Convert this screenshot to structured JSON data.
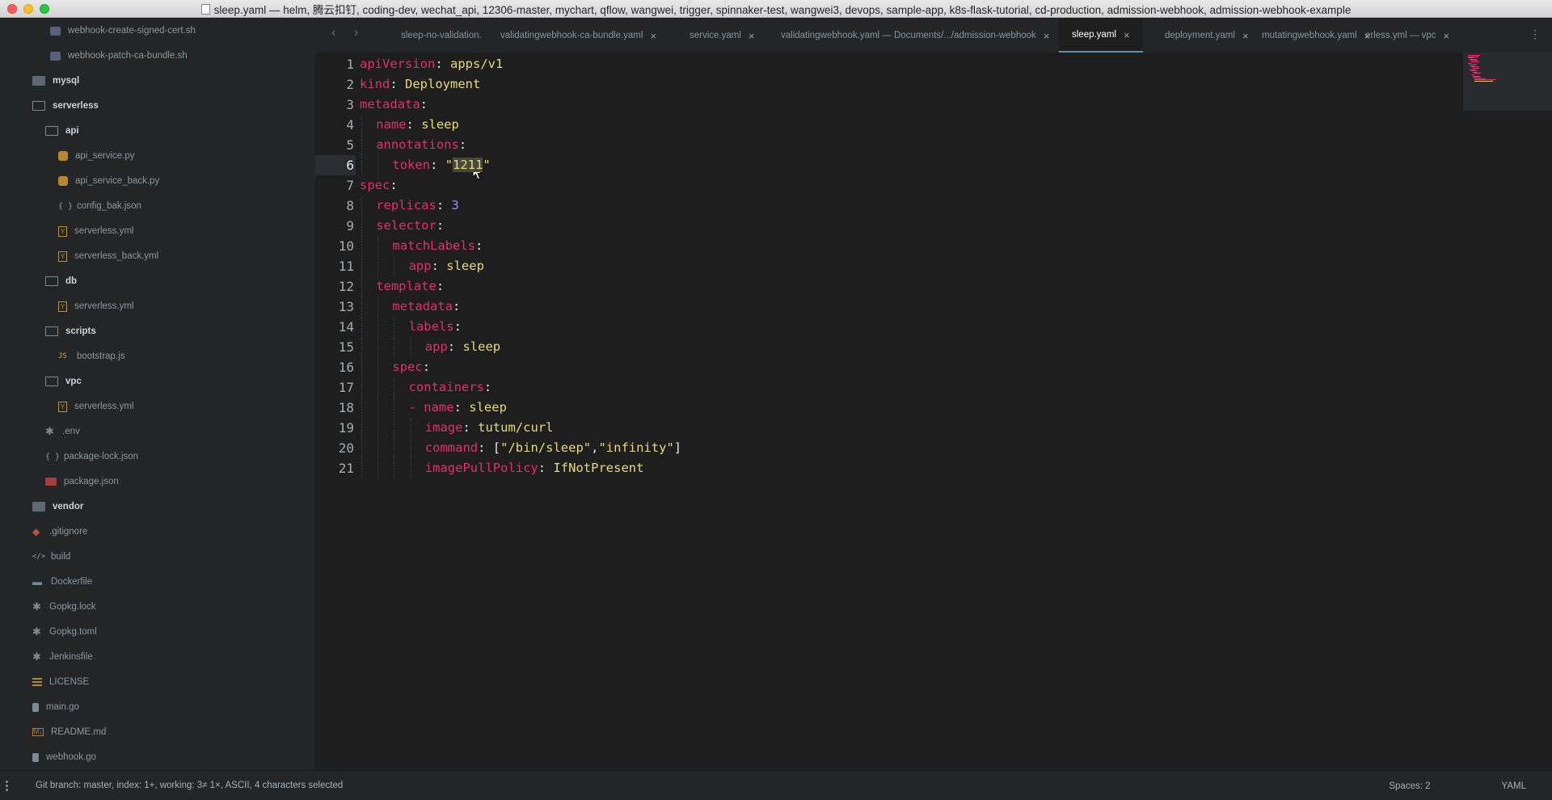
{
  "window": {
    "title": "sleep.yaml — helm, 腾云扣钉, coding-dev, wechat_api, 12306-master, mychart, qflow, wangwei, trigger, spinnaker-test, wangwei3, devops, sample-app, k8s-flask-tutorial, cd-production, admission-webhook, admission-webhook-example"
  },
  "sidebar": {
    "items": [
      {
        "label": "webhook-create-signed-cert.sh",
        "icon": "shell-file-icon",
        "kind": "file"
      },
      {
        "label": "webhook-patch-ca-bundle.sh",
        "icon": "shell-file-icon",
        "kind": "file"
      },
      {
        "label": "mysql",
        "icon": "folder-icon",
        "kind": "folder"
      },
      {
        "label": "serverless",
        "icon": "folder-open-icon",
        "kind": "folder"
      },
      {
        "label": "api",
        "icon": "folder-open-icon",
        "kind": "folder"
      },
      {
        "label": "api_service.py",
        "icon": "python-file-icon",
        "kind": "file"
      },
      {
        "label": "api_service_back.py",
        "icon": "python-file-icon",
        "kind": "file"
      },
      {
        "label": "config_bak.json",
        "icon": "json-file-icon",
        "kind": "file"
      },
      {
        "label": "serverless.yml",
        "icon": "yaml-file-icon",
        "kind": "file"
      },
      {
        "label": "serverless_back.yml",
        "icon": "yaml-file-icon",
        "kind": "file"
      },
      {
        "label": "db",
        "icon": "folder-open-icon",
        "kind": "folder"
      },
      {
        "label": "serverless.yml",
        "icon": "yaml-file-icon",
        "kind": "file"
      },
      {
        "label": "scripts",
        "icon": "folder-open-icon",
        "kind": "folder"
      },
      {
        "label": "bootstrap.js",
        "icon": "js-file-icon",
        "kind": "file"
      },
      {
        "label": "vpc",
        "icon": "folder-open-icon",
        "kind": "folder"
      },
      {
        "label": "serverless.yml",
        "icon": "yaml-file-icon",
        "kind": "file"
      },
      {
        "label": ".env",
        "icon": "asterisk-file-icon",
        "kind": "file"
      },
      {
        "label": "package-lock.json",
        "icon": "json-file-icon",
        "kind": "file"
      },
      {
        "label": "package.json",
        "icon": "npm-package-icon",
        "kind": "file"
      },
      {
        "label": "vendor",
        "icon": "folder-icon",
        "kind": "folder"
      },
      {
        "label": ".gitignore",
        "icon": "git-icon",
        "kind": "file"
      },
      {
        "label": "build",
        "icon": "code-file-icon",
        "kind": "file"
      },
      {
        "label": "Dockerfile",
        "icon": "docker-icon",
        "kind": "file"
      },
      {
        "label": "Gopkg.lock",
        "icon": "asterisk-file-icon",
        "kind": "file"
      },
      {
        "label": "Gopkg.toml",
        "icon": "asterisk-file-icon",
        "kind": "file"
      },
      {
        "label": "Jenkinsfile",
        "icon": "asterisk-file-icon",
        "kind": "file"
      },
      {
        "label": "LICENSE",
        "icon": "text-lines-icon",
        "kind": "file"
      },
      {
        "label": "main.go",
        "icon": "go-file-icon",
        "kind": "file"
      },
      {
        "label": "README.md",
        "icon": "markdown-icon",
        "kind": "file"
      },
      {
        "label": "webhook.go",
        "icon": "go-file-icon",
        "kind": "file"
      }
    ]
  },
  "tabs": [
    {
      "label": "sleep-no-validation.",
      "closable": false,
      "active": false
    },
    {
      "label": "validatingwebhook-ca-bundle.yaml",
      "closable": true,
      "active": false
    },
    {
      "label": "service.yaml",
      "closable": true,
      "active": false
    },
    {
      "label": "validatingwebhook.yaml — Documents/.../admission-webhook",
      "closable": true,
      "active": false
    },
    {
      "label": "sleep.yaml",
      "closable": true,
      "active": true
    },
    {
      "label": "deployment.yaml",
      "closable": true,
      "active": false
    },
    {
      "label": "mutatingwebhook.yaml",
      "closable": true,
      "active": false
    },
    {
      "label": "erless.yml — vpc",
      "closable": true,
      "active": false
    }
  ],
  "tab_close_glyph": "×",
  "editor": {
    "current_line": 6,
    "lines": [
      {
        "n": "1",
        "indent": 0,
        "parts": [
          [
            "k",
            "apiVersion"
          ],
          [
            "p",
            ": "
          ],
          [
            "v",
            "apps/v1"
          ]
        ]
      },
      {
        "n": "2",
        "indent": 0,
        "parts": [
          [
            "k",
            "kind"
          ],
          [
            "p",
            ": "
          ],
          [
            "v",
            "Deployment"
          ]
        ]
      },
      {
        "n": "3",
        "indent": 0,
        "parts": [
          [
            "k",
            "metadata"
          ],
          [
            "p",
            ":"
          ]
        ]
      },
      {
        "n": "4",
        "indent": 1,
        "parts": [
          [
            "k",
            "name"
          ],
          [
            "p",
            ": "
          ],
          [
            "v",
            "sleep"
          ]
        ]
      },
      {
        "n": "5",
        "indent": 1,
        "parts": [
          [
            "k",
            "annotations"
          ],
          [
            "p",
            ":"
          ]
        ]
      },
      {
        "n": "6",
        "indent": 2,
        "parts": [
          [
            "k",
            "token"
          ],
          [
            "p",
            ": "
          ],
          [
            "s",
            "\""
          ],
          [
            "sel",
            "1211"
          ],
          [
            "s",
            "\""
          ]
        ]
      },
      {
        "n": "7",
        "indent": 0,
        "parts": [
          [
            "k",
            "spec"
          ],
          [
            "p",
            ":"
          ]
        ]
      },
      {
        "n": "8",
        "indent": 1,
        "parts": [
          [
            "k",
            "replicas"
          ],
          [
            "p",
            ": "
          ],
          [
            "n",
            "3"
          ]
        ]
      },
      {
        "n": "9",
        "indent": 1,
        "parts": [
          [
            "k",
            "selector"
          ],
          [
            "p",
            ":"
          ]
        ]
      },
      {
        "n": "10",
        "indent": 2,
        "parts": [
          [
            "k",
            "matchLabels"
          ],
          [
            "p",
            ":"
          ]
        ]
      },
      {
        "n": "11",
        "indent": 3,
        "parts": [
          [
            "k",
            "app"
          ],
          [
            "p",
            ": "
          ],
          [
            "v",
            "sleep"
          ]
        ]
      },
      {
        "n": "12",
        "indent": 1,
        "parts": [
          [
            "k",
            "template"
          ],
          [
            "p",
            ":"
          ]
        ]
      },
      {
        "n": "13",
        "indent": 2,
        "parts": [
          [
            "k",
            "metadata"
          ],
          [
            "p",
            ":"
          ]
        ]
      },
      {
        "n": "14",
        "indent": 3,
        "parts": [
          [
            "k",
            "labels"
          ],
          [
            "p",
            ":"
          ]
        ]
      },
      {
        "n": "15",
        "indent": 4,
        "parts": [
          [
            "k",
            "app"
          ],
          [
            "p",
            ": "
          ],
          [
            "v",
            "sleep"
          ]
        ]
      },
      {
        "n": "16",
        "indent": 2,
        "parts": [
          [
            "k",
            "spec"
          ],
          [
            "p",
            ":"
          ]
        ]
      },
      {
        "n": "17",
        "indent": 3,
        "parts": [
          [
            "k",
            "containers"
          ],
          [
            "p",
            ":"
          ]
        ]
      },
      {
        "n": "18",
        "indent": 3,
        "parts": [
          [
            "k",
            "- "
          ],
          [
            "k",
            "name"
          ],
          [
            "p",
            ": "
          ],
          [
            "v",
            "sleep"
          ]
        ]
      },
      {
        "n": "19",
        "indent": 4,
        "parts": [
          [
            "k",
            "image"
          ],
          [
            "p",
            ": "
          ],
          [
            "v",
            "tutum/curl"
          ]
        ]
      },
      {
        "n": "20",
        "indent": 4,
        "parts": [
          [
            "k",
            "command"
          ],
          [
            "p",
            ": ["
          ],
          [
            "s",
            "\"/bin/sleep\""
          ],
          [
            "p",
            ","
          ],
          [
            "s",
            "\"infinity\""
          ],
          [
            "p",
            "]"
          ]
        ]
      },
      {
        "n": "21",
        "indent": 4,
        "parts": [
          [
            "k",
            "imagePullPolicy"
          ],
          [
            "p",
            ": "
          ],
          [
            "v",
            "IfNotPresent"
          ]
        ]
      }
    ]
  },
  "colors": {
    "key": "#e0306c",
    "value": "#e6db74",
    "number": "#ae81ff",
    "accent": "#5d8fb0"
  },
  "statusbar": {
    "left": "Git branch: master, index: 1+, working: 3≠ 1×, ASCII, 4 characters selected",
    "spaces": "Spaces: 2",
    "syntax": "YAML"
  }
}
